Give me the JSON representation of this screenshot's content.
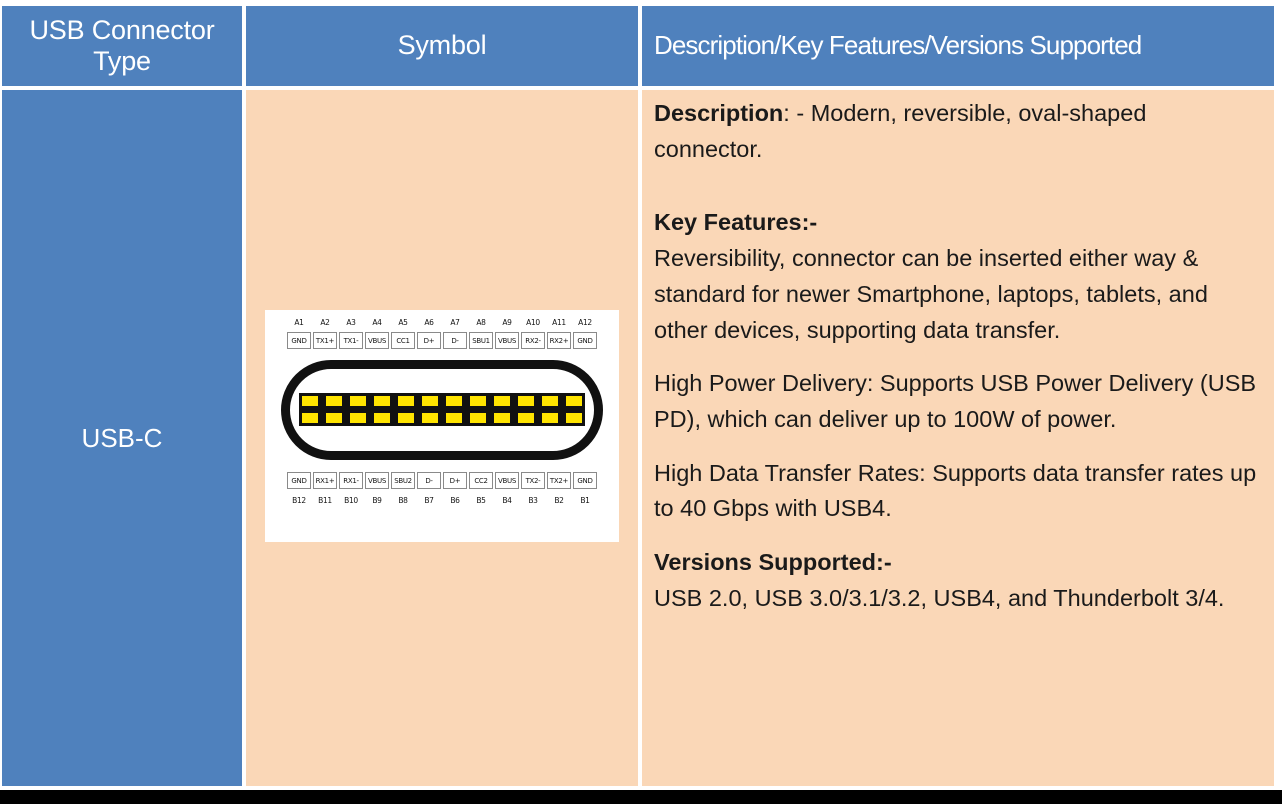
{
  "table": {
    "headers": {
      "col1": "USB Connector Type",
      "col2": "Symbol",
      "col3": "Description/Key Features/Versions Supported"
    },
    "row": {
      "connector_type": "USB-C",
      "description_label": "Description",
      "description_text": ": - Modern, reversible, oval-shaped connector.",
      "key_features_label": "Key Features:-",
      "key_features_text": "Reversibility, connector can be inserted either way & standard for newer Smartphone, laptops, tablets, and other devices, supporting data transfer.",
      "power_delivery_text": "High Power Delivery: Supports USB Power Delivery (USB PD), which can deliver up to 100W of power.",
      "data_rates_text": "High Data Transfer Rates: Supports data transfer rates up to 40 Gbps with USB4.",
      "versions_label": "Versions Supported:-",
      "versions_text": "USB 2.0, USB 3.0/3.1/3.2, USB4, and Thunderbolt 3/4."
    }
  },
  "pinout": {
    "top_numbers": [
      "A1",
      "A2",
      "A3",
      "A4",
      "A5",
      "A6",
      "A7",
      "A8",
      "A9",
      "A10",
      "A11",
      "A12"
    ],
    "top_names": [
      "GND",
      "TX1+",
      "TX1-",
      "VBUS",
      "CC1",
      "D+",
      "D-",
      "SBU1",
      "VBUS",
      "RX2-",
      "RX2+",
      "GND"
    ],
    "bottom_names": [
      "GND",
      "RX1+",
      "RX1-",
      "VBUS",
      "SBU2",
      "D-",
      "D+",
      "CC2",
      "VBUS",
      "TX2-",
      "TX2+",
      "GND"
    ],
    "bottom_numbers": [
      "B12",
      "B11",
      "B10",
      "B9",
      "B8",
      "B7",
      "B6",
      "B5",
      "B4",
      "B3",
      "B2",
      "B1"
    ],
    "pin_count": 12
  },
  "colors": {
    "header_blue": "#4f81bd",
    "cell_peach": "#fad7b7",
    "pin_yellow": "#ffe400",
    "shell_black": "#111111",
    "border_black": "#000000"
  }
}
